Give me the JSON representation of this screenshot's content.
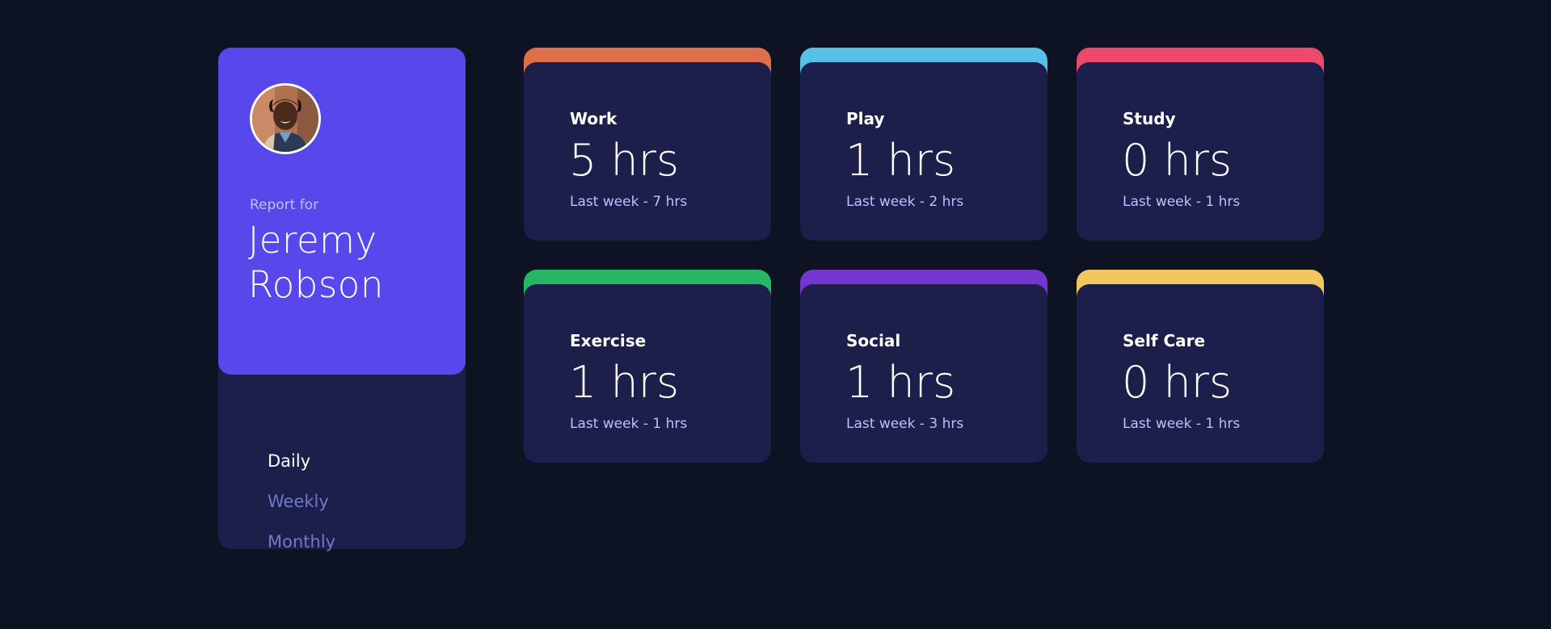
{
  "profile": {
    "report_label": "Report for",
    "name": "Jeremy Robson",
    "avatar_alt": "Jeremy Robson avatar"
  },
  "periods": [
    {
      "label": "Daily",
      "active": true
    },
    {
      "label": "Weekly",
      "active": false
    },
    {
      "label": "Monthly",
      "active": false
    }
  ],
  "activities": [
    {
      "title": "Work",
      "current": "5 hrs",
      "previous": "Last week - 7 hrs",
      "accent_color": "#de6f4d",
      "icon": "work-icon"
    },
    {
      "title": "Play",
      "current": "1 hrs",
      "previous": "Last week - 2 hrs",
      "accent_color": "#56c0e8",
      "icon": "play-icon"
    },
    {
      "title": "Study",
      "current": "0 hrs",
      "previous": "Last week - 1 hrs",
      "accent_color": "#ec4a6c",
      "icon": "study-icon"
    },
    {
      "title": "Exercise",
      "current": "1 hrs",
      "previous": "Last week - 1 hrs",
      "accent_color": "#26b765",
      "icon": "exercise-icon"
    },
    {
      "title": "Social",
      "current": "1 hrs",
      "previous": "Last week - 3 hrs",
      "accent_color": "#7436ce",
      "icon": "social-icon"
    },
    {
      "title": "Self Care",
      "current": "0 hrs",
      "previous": "Last week - 1 hrs",
      "accent_color": "#f2c75e",
      "icon": "self-care-icon"
    }
  ],
  "colors": {
    "background": "#0d1323",
    "card": "#1c1f4a",
    "profile": "#5847eb",
    "muted_text": "#bbc0ff",
    "inactive_period": "#7078c9"
  }
}
